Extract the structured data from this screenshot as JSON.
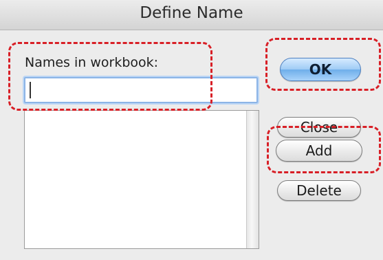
{
  "dialog": {
    "title": "Define Name",
    "names_label": "Names in workbook:",
    "name_input_value": "",
    "names_list": []
  },
  "buttons": {
    "ok": "OK",
    "close": "Close",
    "add": "Add",
    "delete": "Delete"
  },
  "highlight_color": "#d81f26",
  "default_button_color": "#6eaeea"
}
